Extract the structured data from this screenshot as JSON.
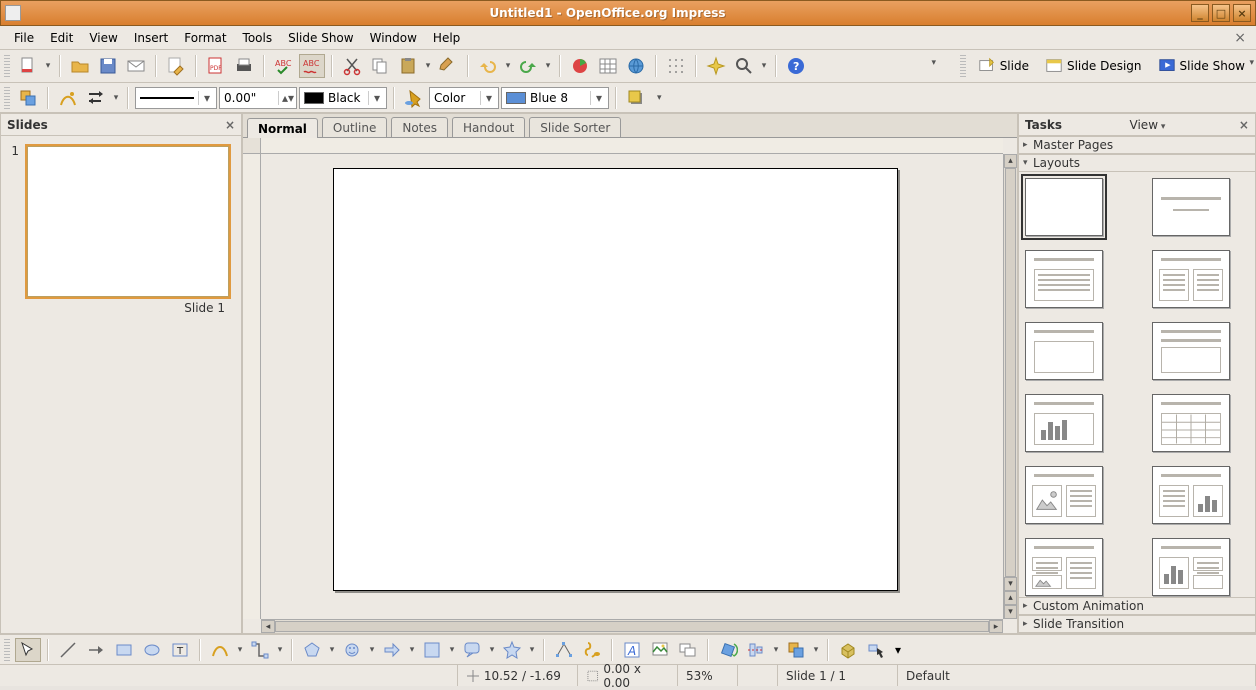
{
  "window": {
    "title": "Untitled1 - OpenOffice.org Impress"
  },
  "menu": {
    "items": [
      "File",
      "Edit",
      "View",
      "Insert",
      "Format",
      "Tools",
      "Slide Show",
      "Window",
      "Help"
    ]
  },
  "toolbar1": {
    "right_buttons": {
      "slide": "Slide",
      "slide_design": "Slide Design",
      "slide_show": "Slide Show"
    }
  },
  "toolbar2": {
    "line_width": "0.00\"",
    "line_color_label": "Black",
    "line_color": "#000000",
    "fill_mode": "Color",
    "fill_label": "Blue 8",
    "fill_color": "#5b8fd6"
  },
  "slides_panel": {
    "title": "Slides",
    "thumbs": [
      {
        "num": "1",
        "label": "Slide 1"
      }
    ]
  },
  "view_tabs": {
    "items": [
      "Normal",
      "Outline",
      "Notes",
      "Handout",
      "Slide Sorter"
    ],
    "active": 0
  },
  "tasks_panel": {
    "title": "Tasks",
    "view_label": "View",
    "sections": {
      "master_pages": "Master Pages",
      "layouts": "Layouts",
      "custom_animation": "Custom Animation",
      "slide_transition": "Slide Transition"
    }
  },
  "statusbar": {
    "pos": "10.52 / -1.69",
    "size": "0.00 x 0.00",
    "zoom": "53%",
    "slide": "Slide 1 / 1",
    "template": "Default"
  }
}
